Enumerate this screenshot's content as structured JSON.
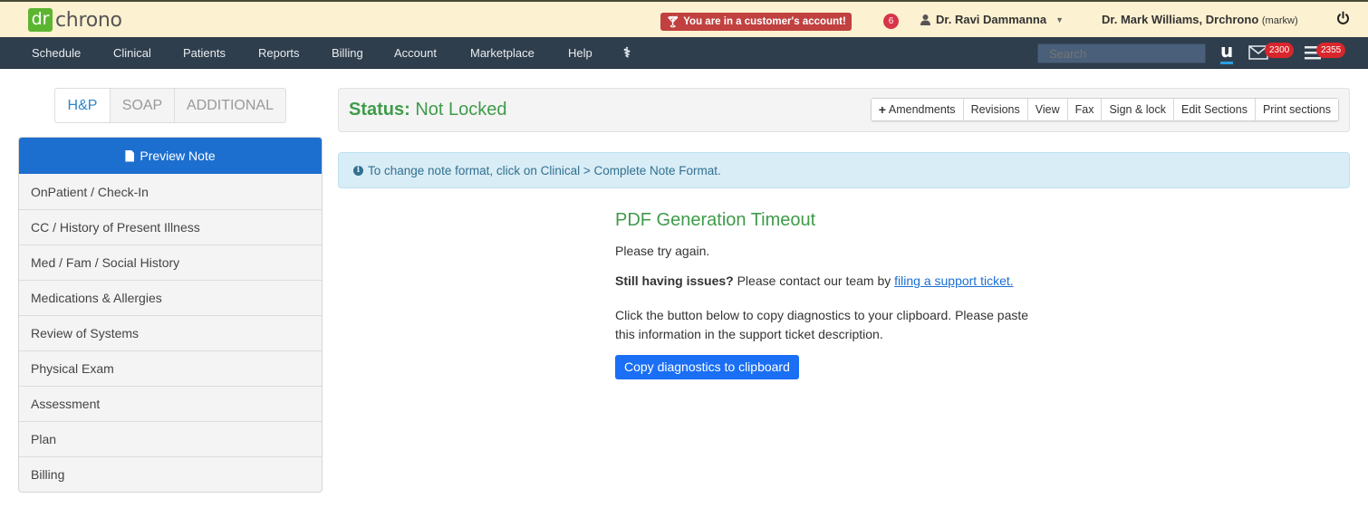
{
  "header": {
    "logo_mark": "dr",
    "logo_text": "chrono",
    "customer_alert": "You are in a customer's account!",
    "notification_count": "6",
    "current_user": "Dr. Ravi Dammanna",
    "account_name": "Dr. Mark Williams, Drchrono",
    "account_handle": "(markw)"
  },
  "nav": {
    "items": [
      "Schedule",
      "Clinical",
      "Patients",
      "Reports",
      "Billing",
      "Account",
      "Marketplace",
      "Help"
    ],
    "search_placeholder": "Search",
    "u_label": "u",
    "mail_count": "2300",
    "tasks_count": "2355"
  },
  "format_tabs": [
    {
      "label": "H&P",
      "active": true
    },
    {
      "label": "SOAP",
      "active": false
    },
    {
      "label": "ADDITIONAL",
      "active": false
    }
  ],
  "sections": {
    "preview_label": "Preview Note",
    "items": [
      "OnPatient / Check-In",
      "CC / History of Present Illness",
      "Med / Fam / Social History",
      "Medications & Allergies",
      "Review of Systems",
      "Physical Exam",
      "Assessment",
      "Plan",
      "Billing"
    ]
  },
  "status": {
    "label": "Status:",
    "value": "Not Locked",
    "actions": [
      "Amendments",
      "Revisions",
      "View",
      "Fax",
      "Sign & lock",
      "Edit Sections",
      "Print sections"
    ]
  },
  "info_alert": "To change note format, click on Clinical > Complete Note Format.",
  "error": {
    "title": "PDF Generation Timeout",
    "retry_text": "Please try again.",
    "still_issues_bold": "Still having issues?",
    "still_issues_text": " Please contact our team by ",
    "support_link": "filing a support ticket.",
    "instructions_line1": "Click the button below to copy diagnostics to your clipboard. Please paste",
    "instructions_line2": "this information in the support ticket description.",
    "copy_button": "Copy diagnostics to clipboard"
  },
  "colors": {
    "topbar_bg": "#fcf1d1",
    "navbar_bg": "#2f3e4d",
    "primary_blue": "#1d6fcf",
    "status_green": "#3f9b4a",
    "alert_red": "#c0413f",
    "info_bg": "#d9edf7"
  }
}
